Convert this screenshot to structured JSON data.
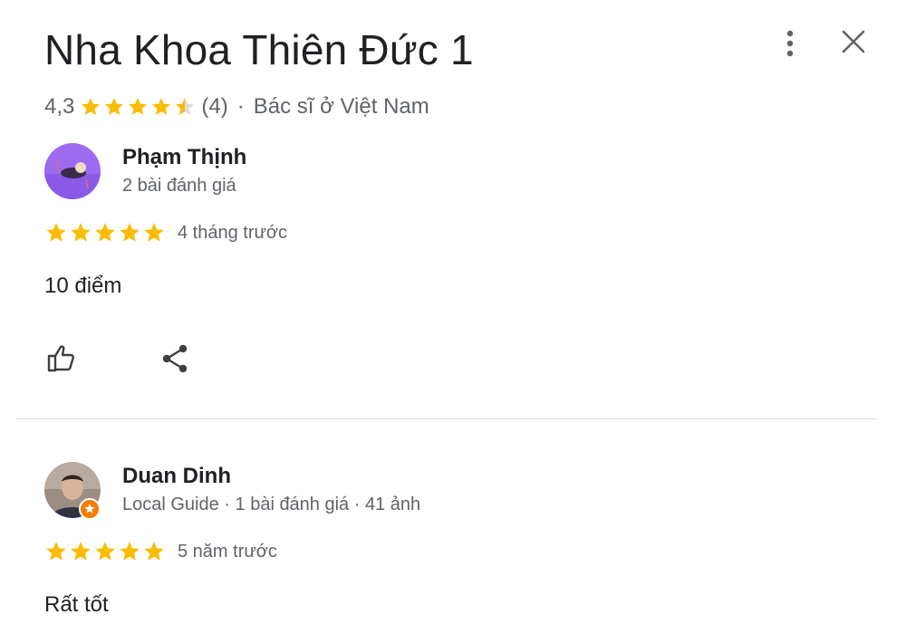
{
  "place": {
    "title": "Nha Khoa Thiên Đức 1",
    "rating": "4,3",
    "rating_value": 4.3,
    "review_count": "(4)",
    "separator": "·",
    "category": "Bác sĩ ở Việt Nam"
  },
  "header": {
    "more_icon": "more-vert-icon",
    "close_icon": "close-icon"
  },
  "colors": {
    "star": "#fbbc04",
    "star_empty": "#dadce0",
    "text_primary": "#202124",
    "text_secondary": "#5f6368",
    "local_guide_badge": "#f57c00"
  },
  "reviews": [
    {
      "author": "Phạm Thịnh",
      "meta": "2 bài đánh giá",
      "stars": 5,
      "time": "4 tháng trước",
      "text": "10 điểm",
      "actions": [
        "like-icon",
        "share-icon"
      ]
    },
    {
      "author": "Duan Dinh",
      "meta": "Local Guide · 1 bài đánh giá · 41 ảnh",
      "stars": 5,
      "time": "5 năm trước",
      "text": "Rất tốt"
    }
  ]
}
